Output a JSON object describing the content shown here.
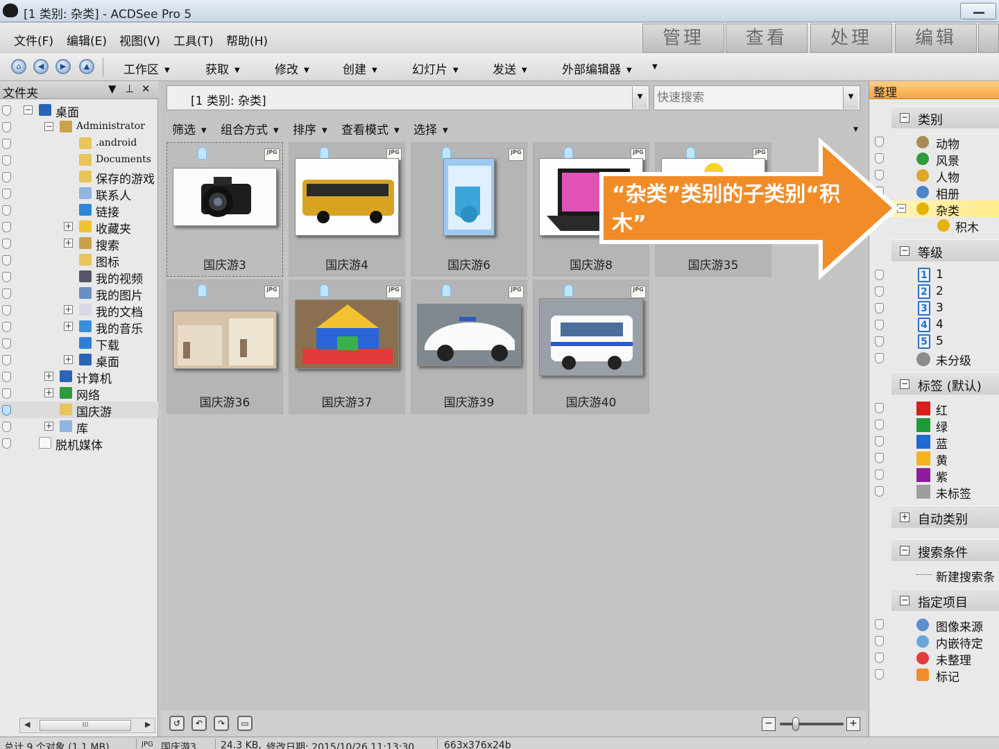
{
  "window": {
    "title": "[1 类别: 杂类] - ACDSee Pro 5"
  },
  "menu": [
    "文件(F)",
    "编辑(E)",
    "视图(V)",
    "工具(T)",
    "帮助(H)"
  ],
  "mode_tabs": [
    "管理",
    "查看",
    "处理",
    "编辑"
  ],
  "toolbar": {
    "items": [
      "工作区",
      "获取",
      "修改",
      "创建",
      "幻灯片",
      "发送",
      "外部编辑器"
    ]
  },
  "folders_panel": {
    "title": "文件夹",
    "tree": [
      {
        "label": "桌面",
        "indent": 0,
        "expander": "−",
        "icon": "desktop"
      },
      {
        "label": "Administrator",
        "indent": 1,
        "expander": "−",
        "icon": "user",
        "mono": true
      },
      {
        "label": ".android",
        "indent": 2,
        "icon": "folder",
        "mono": true
      },
      {
        "label": "Documents",
        "indent": 2,
        "icon": "folder",
        "mono": true
      },
      {
        "label": "保存的游戏",
        "indent": 2,
        "icon": "folder"
      },
      {
        "label": "联系人",
        "indent": 2,
        "icon": "contacts"
      },
      {
        "label": "链接",
        "indent": 2,
        "icon": "link"
      },
      {
        "label": "收藏夹",
        "indent": 2,
        "expander": "+",
        "icon": "star"
      },
      {
        "label": "搜索",
        "indent": 2,
        "expander": "+",
        "icon": "search"
      },
      {
        "label": "图标",
        "indent": 2,
        "icon": "folder"
      },
      {
        "label": "我的视频",
        "indent": 2,
        "icon": "video"
      },
      {
        "label": "我的图片",
        "indent": 2,
        "icon": "pictures"
      },
      {
        "label": "我的文档",
        "indent": 2,
        "expander": "+",
        "icon": "docs"
      },
      {
        "label": "我的音乐",
        "indent": 2,
        "expander": "+",
        "icon": "music"
      },
      {
        "label": "下载",
        "indent": 2,
        "icon": "download"
      },
      {
        "label": "桌面",
        "indent": 2,
        "expander": "+",
        "icon": "desktop"
      },
      {
        "label": "计算机",
        "indent": 1,
        "expander": "+",
        "icon": "computer"
      },
      {
        "label": "网络",
        "indent": 1,
        "expander": "+",
        "icon": "network"
      },
      {
        "label": "国庆游",
        "indent": 1,
        "icon": "folder",
        "selected": true
      },
      {
        "label": "库",
        "indent": 1,
        "expander": "+",
        "icon": "library"
      },
      {
        "label": "脱机媒体",
        "indent": 0,
        "icon": "media"
      }
    ]
  },
  "path": {
    "value": "[1 类别: 杂类]"
  },
  "search": {
    "placeholder": "快速搜索"
  },
  "filterbar": [
    "筛选",
    "组合方式",
    "排序",
    "查看模式",
    "选择"
  ],
  "thumbnails": [
    {
      "name": "国庆游3",
      "selected": true,
      "img": "camera"
    },
    {
      "name": "国庆游4",
      "img": "bus"
    },
    {
      "name": "国庆游6",
      "img": "glass"
    },
    {
      "name": "国庆游8",
      "img": "laptop"
    },
    {
      "name": "国庆游35",
      "img": "flower"
    },
    {
      "name": "国庆游36",
      "img": "blocks"
    },
    {
      "name": "国庆游37",
      "img": "lego"
    },
    {
      "name": "国庆游39",
      "img": "police"
    },
    {
      "name": "国庆游40",
      "img": "ambulance"
    }
  ],
  "organize_panel": {
    "title": "整理",
    "categories": {
      "title": "类别",
      "items": [
        {
          "label": "动物",
          "icon": "animal-icon",
          "color": "#a98a55"
        },
        {
          "label": "风景",
          "icon": "globe-icon",
          "color": "#2f9a3c"
        },
        {
          "label": "人物",
          "icon": "people-icon",
          "color": "#e0a62a"
        },
        {
          "label": "相册",
          "icon": "album-icon",
          "color": "#4a86c8"
        },
        {
          "label": "杂类",
          "icon": "misc-icon",
          "color": "#e6b400",
          "selected": true
        },
        {
          "label": "积木",
          "icon": "misc-icon",
          "color": "#e6b400",
          "child": true
        }
      ]
    },
    "ratings": {
      "title": "等级",
      "items": [
        "1",
        "2",
        "3",
        "4",
        "5"
      ],
      "unrated": "未分级"
    },
    "labels": {
      "title": "标签 (默认)",
      "items": [
        {
          "label": "红",
          "color": "#d81e1e"
        },
        {
          "label": "绿",
          "color": "#1f9a3a"
        },
        {
          "label": "蓝",
          "color": "#1e6ad2"
        },
        {
          "label": "黄",
          "color": "#f6b11f"
        },
        {
          "label": "紫",
          "color": "#8a1e9a"
        },
        {
          "label": "未标签",
          "color": "#9e9e9e"
        }
      ]
    },
    "auto_categories": {
      "title": "自动类别"
    },
    "saved_searches": {
      "title": "搜索条件",
      "new_item": "新建搜索条"
    },
    "special_items": {
      "title": "指定项目",
      "items": [
        "图像来源",
        "内嵌待定",
        "未整理",
        "标记"
      ]
    }
  },
  "callout": {
    "text": "“杂类”类别的子类别“积木”",
    "color": "#f28c28"
  },
  "statusbar": {
    "total": "总计 9 个对象 (1.1 MB)",
    "file": "国庆游3",
    "size": "24.3 KB,",
    "modified": "修改日期: 2015/10/26 11:13:30",
    "dims": "663x376x24b"
  }
}
